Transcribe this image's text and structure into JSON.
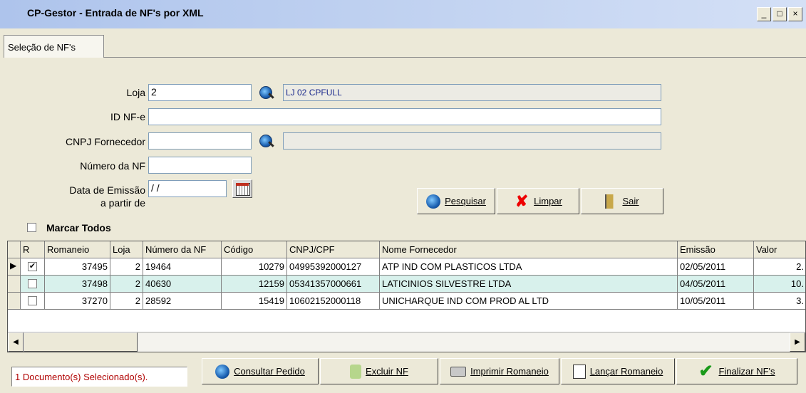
{
  "window": {
    "title": "CP-Gestor - Entrada de NF's por XML",
    "controls": {
      "minimize": "_",
      "maximize": "□",
      "close": "×"
    }
  },
  "tab": {
    "label": "Seleção de NF's"
  },
  "form": {
    "loja": {
      "label": "Loja",
      "value": "2",
      "description": "LJ 02 CPFULL"
    },
    "id_nfe": {
      "label": "ID NF-e",
      "value": ""
    },
    "cnpj_fornecedor": {
      "label": "CNPJ Fornecedor",
      "value": "",
      "description": ""
    },
    "numero_nf": {
      "label": "Número da NF",
      "value": ""
    },
    "data_emissao": {
      "label_line1": "Data de Emissão",
      "label_line2": "a partir de",
      "value": " / /"
    },
    "marcar_todos": {
      "label": "Marcar Todos",
      "checked": false
    }
  },
  "buttons": {
    "pesquisar": "Pesquisar",
    "limpar": "Limpar",
    "sair": "Sair"
  },
  "grid": {
    "columns": [
      "R",
      "Romaneio",
      "Loja",
      "Número da NF",
      "Código",
      "CNPJ/CPF",
      "Nome Fornecedor",
      "Emissão",
      "Valor"
    ],
    "rows": [
      {
        "checked": true,
        "check": "✔",
        "romaneio": "37495",
        "loja": "2",
        "numero_nf": "19464",
        "codigo": "10279",
        "cnpj": "04995392000127",
        "fornecedor": "ATP IND COM PLASTICOS LTDA",
        "emissao": "02/05/2011",
        "valor": "2."
      },
      {
        "checked": false,
        "check": "",
        "romaneio": "37498",
        "loja": "2",
        "numero_nf": "40630",
        "codigo": "12159",
        "cnpj": "05341357000661",
        "fornecedor": "LATICINIOS SILVESTRE LTDA",
        "emissao": "04/05/2011",
        "valor": "10."
      },
      {
        "checked": false,
        "check": "",
        "romaneio": "37270",
        "loja": "2",
        "numero_nf": "28592",
        "codigo": "15419",
        "cnpj": "10602152000118",
        "fornecedor": "UNICHARQUE IND COM PROD AL LTD",
        "emissao": "10/05/2011",
        "valor": "3."
      }
    ]
  },
  "status": {
    "text": "1 Documento(s) Selecionado(s)."
  },
  "footer_buttons": {
    "consultar_pedido": "Consultar Pedido",
    "excluir_nf": "Excluir NF",
    "imprimir_romaneio": "Imprimir Romaneio",
    "lancar_romaneio": "Lançar Romaneio",
    "finalizar_nfs": "Finalizar NF's"
  },
  "colors": {
    "titlebar": "#aec4ec",
    "row_selected": "#d8f1ec",
    "status_text": "#b00000"
  }
}
